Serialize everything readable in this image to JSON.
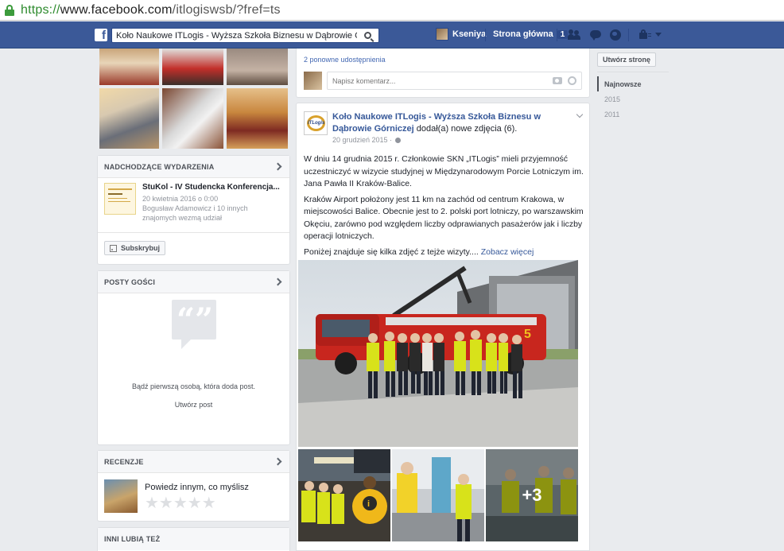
{
  "browser": {
    "url_scheme": "https://",
    "url_host": "www.facebook.com",
    "url_path": "/itlogiswsb/?fref=ts"
  },
  "header": {
    "logo": "f",
    "search_value": "Koło Naukowe ITLogis - Wyższa Szkoła Biznesu w Dąbrowie Górniczej",
    "user_name": "Kseniya",
    "home_label": "Strona główna",
    "home_count": "1",
    "brand_color": "#3b5998"
  },
  "left": {
    "events": {
      "title": "NADCHODZĄCE WYDARZENIA",
      "event_title": "StuKol - IV Studencka Konferencja...",
      "event_date": "20 kwietnia 2016 o 0:00",
      "event_attendees": "Bogusław Adamowicz i 10 innych znajomych wezmą udział",
      "subscribe_label": "Subskrybuj"
    },
    "guest_posts": {
      "title": "POSTY GOŚCI",
      "empty_text": "Bądź pierwszą osobą, która doda post.",
      "create_link": "Utwórz post"
    },
    "reviews": {
      "title": "RECENZJE",
      "prompt": "Powiedz innym, co myślisz",
      "stars": "★★★★★"
    },
    "others_like": {
      "title": "INNI LUBIĄ TEŻ"
    }
  },
  "center": {
    "prev_post": {
      "shares": "2 ponowne udostępnienia",
      "comment_placeholder": "Napisz komentarz..."
    },
    "post": {
      "logo_text": "ITLogis",
      "author": "Koło Naukowe ITLogis - Wyższa Szkoła Biznesu w Dąbrowie Górniczej",
      "action": "dodał(a) nowe zdjęcia (6).",
      "date": "20 grudzień 2015 ·",
      "paragraph1": "W dniu 14 grudnia 2015 r. Członkowie SKN „ITLogis” mieli przyjemność uczestniczyć w wizycie studyjnej w Międzynarodowym Porcie Lotniczym im. Jana Pawła II Kraków-Balice.",
      "paragraph2": "Kraków Airport położony jest 11 km na zachód od centrum Krakowa, w miejscowości Balice. Obecnie jest to 2. polski port lotniczy, po warszawskim Okęciu, zarówno pod względem liczby odprawianych pasażerów jak i liczby operacji lotniczych.",
      "paragraph3": "Poniżej znajduje się kilka zdjęć z tejże wizyty....",
      "see_more": "Zobacz więcej",
      "more_photos": "+3"
    }
  },
  "right": {
    "create_page": "Utwórz stronę",
    "timeline": [
      "Najnowsze",
      "2015",
      "2011"
    ]
  }
}
